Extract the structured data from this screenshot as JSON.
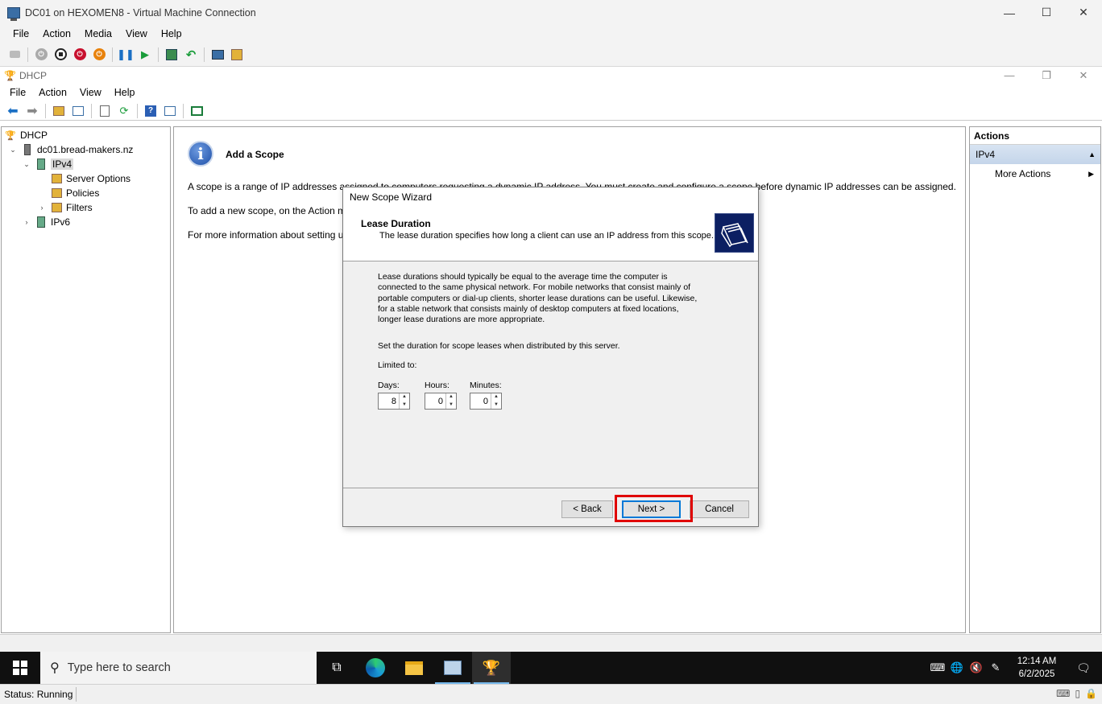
{
  "vm_window": {
    "title": "DC01 on HEXOMEN8 - Virtual Machine Connection",
    "menu": [
      "File",
      "Action",
      "Media",
      "View",
      "Help"
    ],
    "controls": {
      "minimize": "—",
      "maximize": "☐",
      "close": "✕"
    }
  },
  "guest_window": {
    "title": "DHCP",
    "menu": [
      "File",
      "Action",
      "View",
      "Help"
    ],
    "controls": {
      "minimize": "—",
      "restore": "❐",
      "close": "✕"
    }
  },
  "tree": {
    "items": [
      {
        "label": "DHCP",
        "expander": ""
      },
      {
        "label": "dc01.bread-makers.nz",
        "expander": "⌄"
      },
      {
        "label": "IPv4",
        "expander": "⌄"
      },
      {
        "label": "Server Options",
        "expander": ""
      },
      {
        "label": "Policies",
        "expander": ""
      },
      {
        "label": "Filters",
        "expander": "›"
      },
      {
        "label": "IPv6",
        "expander": "›"
      }
    ]
  },
  "content": {
    "title": "Add a Scope",
    "para1": "A scope is a range of IP addresses assigned to computers requesting a dynamic IP address. You must create and configure a scope before dynamic IP addresses can be assigned.",
    "para2": "To add a new scope, on the Action m",
    "para3": "For more information about setting u"
  },
  "actions": {
    "header": "Actions",
    "section": "IPv4",
    "more": "More Actions"
  },
  "wizard": {
    "window_title": "New Scope Wizard",
    "heading": "Lease Duration",
    "subheading": "The lease duration specifies how long a client can use an IP address from this scope.",
    "description": "Lease durations should typically be equal to the average time the computer is connected to the same physical network. For mobile networks that consist mainly of portable computers or dial-up clients, shorter lease durations can be useful. Likewise, for a stable network that consists mainly of desktop computers at fixed locations, longer lease durations are more appropriate.",
    "instruction": "Set the duration for scope leases when distributed by this server.",
    "limited_to": "Limited to:",
    "days_label": "Days:",
    "hours_label": "Hours:",
    "minutes_label": "Minutes:",
    "days_value": "8",
    "hours_value": "0",
    "minutes_value": "0",
    "back_button": "< Back",
    "next_button": "Next >",
    "cancel_button": "Cancel"
  },
  "taskbar": {
    "search_placeholder": "Type here to search",
    "time": "12:14 AM",
    "date": "6/2/2025"
  },
  "vm_status": "Status: Running",
  "colors": {
    "highlight": "#e00000",
    "accent": "#0078d7"
  }
}
